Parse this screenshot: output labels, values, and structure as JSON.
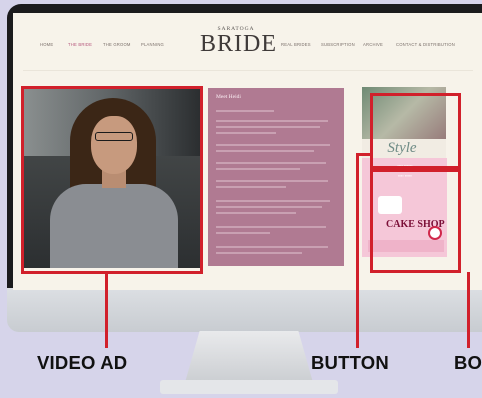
{
  "site": {
    "nav_left": [
      "HOME",
      "THE BRIDE",
      "THE GROOM",
      "PLANNING"
    ],
    "nav_right": [
      "REAL BRIDES",
      "SUBSCRIPTION",
      "ARCHIVE",
      "CONTACT & DISTRIBUTION"
    ],
    "active_nav": "THE BRIDE",
    "logo_top": "SARATOGA",
    "logo_main": "BRIDE"
  },
  "content": {
    "panel_title": "Meet Heidi"
  },
  "ads": {
    "style_ad_text": "Style",
    "cake_brand": "CAKE SHOP"
  },
  "callouts": {
    "video_ad": "VIDEO AD",
    "button": "BUTTON",
    "box_partial": "BO"
  },
  "colors": {
    "highlight": "#d1202b",
    "accent_pink": "#b07a92",
    "background": "#d6d4ea"
  }
}
